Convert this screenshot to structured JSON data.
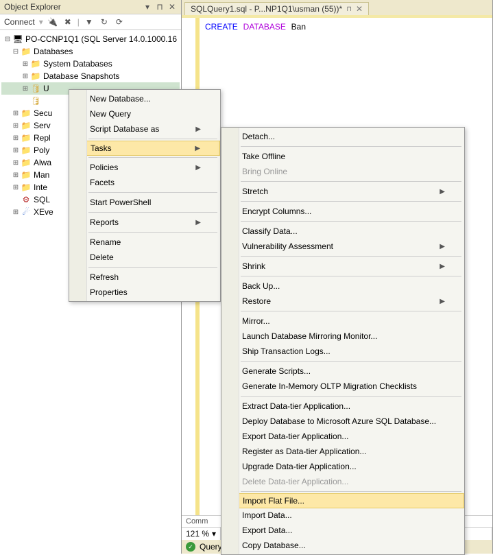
{
  "oe": {
    "title": "Object Explorer",
    "connect": "Connect",
    "server": "PO-CCNP1Q1 (SQL Server 14.0.1000.16",
    "nodes": {
      "databases": "Databases",
      "sysdb": "System Databases",
      "snapshots": "Database Snapshots",
      "u": "U",
      "secu": "Secu",
      "serv": "Serv",
      "repl": "Repl",
      "poly": "Poly",
      "alwa": "Alwa",
      "man": "Man",
      "inte": "Inte",
      "sql": "SQL",
      "xeve": "XEve"
    }
  },
  "tab": {
    "label": "SQLQuery1.sql - P...NP1Q1\\usman (55))*"
  },
  "code": {
    "kw1": "CREATE",
    "kw2": "DATABASE",
    "ident": "Ban"
  },
  "commandsTab": "Comm",
  "zoom": "121 %",
  "status": "Query e",
  "menu1": {
    "newdb": "New Database...",
    "newquery": "New Query",
    "scriptdb": "Script Database as",
    "tasks": "Tasks",
    "policies": "Policies",
    "facets": "Facets",
    "powershell": "Start PowerShell",
    "reports": "Reports",
    "rename": "Rename",
    "delete": "Delete",
    "refresh": "Refresh",
    "properties": "Properties"
  },
  "menu2": {
    "detach": "Detach...",
    "offline": "Take Offline",
    "online": "Bring Online",
    "stretch": "Stretch",
    "encrypt": "Encrypt Columns...",
    "classify": "Classify Data...",
    "vuln": "Vulnerability Assessment",
    "shrink": "Shrink",
    "backup": "Back Up...",
    "restore": "Restore",
    "mirror": "Mirror...",
    "launchmirror": "Launch Database Mirroring Monitor...",
    "shiptx": "Ship Transaction Logs...",
    "genscripts": "Generate Scripts...",
    "geninmem": "Generate In-Memory OLTP Migration Checklists",
    "extractdac": "Extract Data-tier Application...",
    "deployazure": "Deploy Database to Microsoft Azure SQL Database...",
    "exportdac": "Export Data-tier Application...",
    "regdac": "Register as Data-tier Application...",
    "upgradedac": "Upgrade Data-tier Application...",
    "deletedac": "Delete Data-tier Application...",
    "importflat": "Import Flat File...",
    "importdata": "Import Data...",
    "exportdata": "Export Data...",
    "copydb": "Copy Database..."
  }
}
